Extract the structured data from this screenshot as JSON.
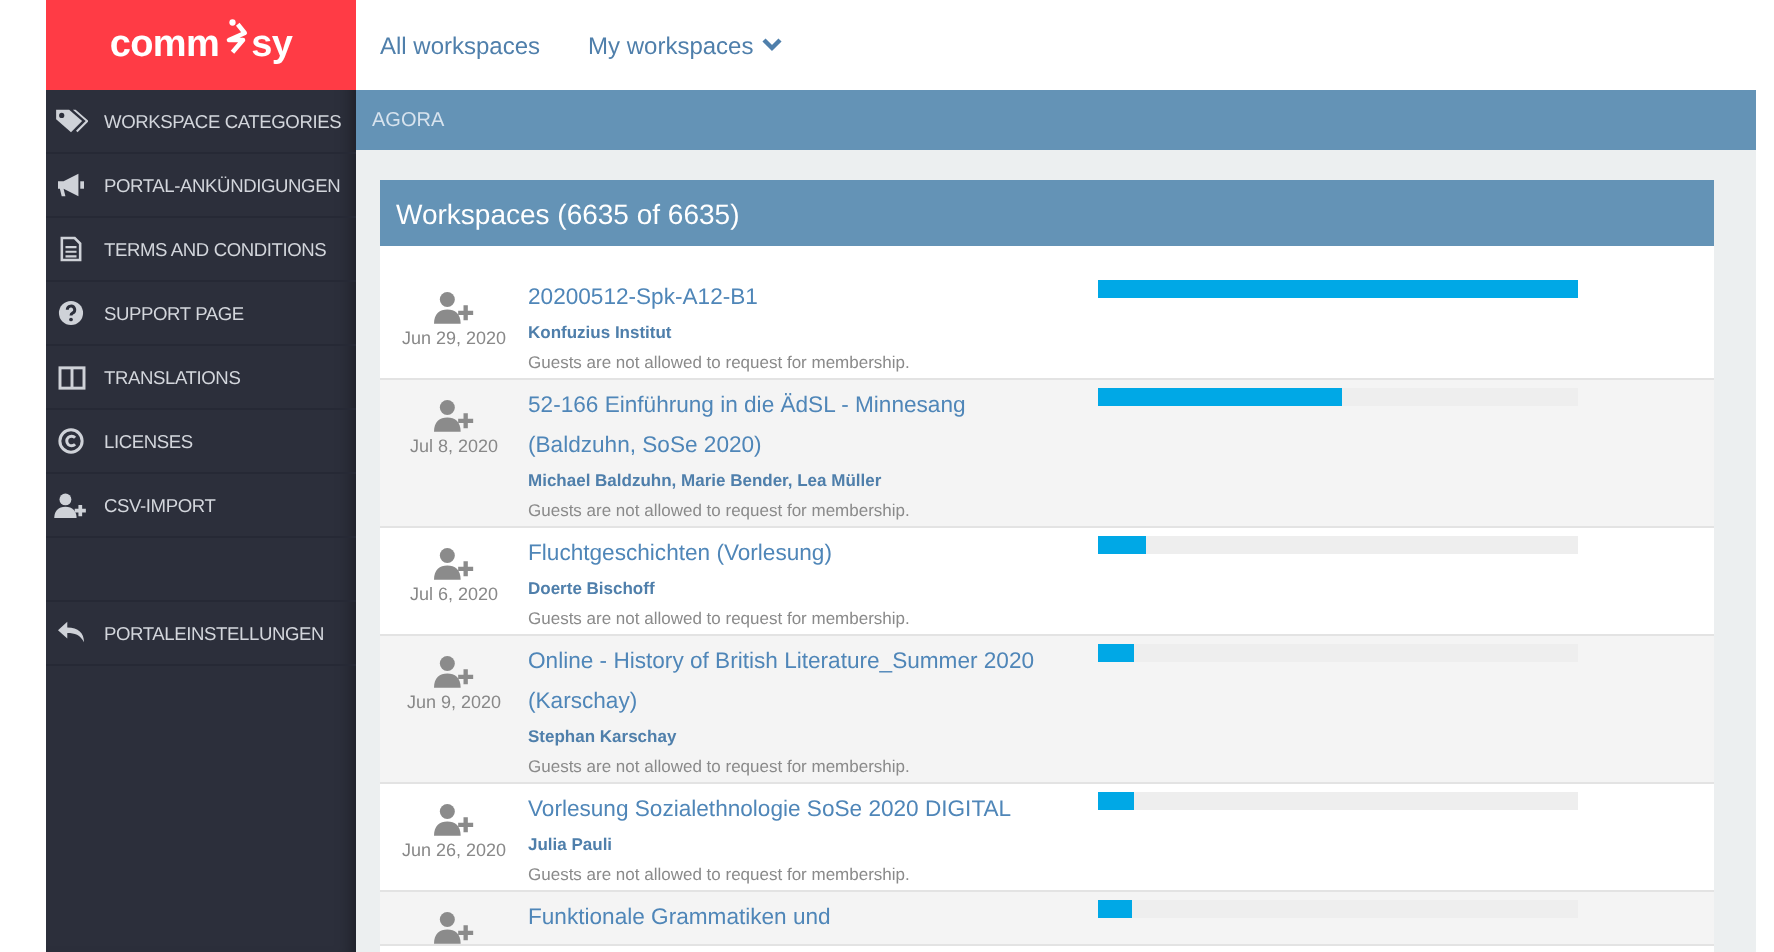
{
  "logo": {
    "left": "comm",
    "right": "sy"
  },
  "top_nav": [
    {
      "label": "All workspaces",
      "dropdown": false
    },
    {
      "label": "My workspaces",
      "dropdown": true
    }
  ],
  "sidebar": {
    "items": [
      {
        "label": "WORKSPACE CATEGORIES"
      },
      {
        "label": "PORTAL-ANKÜNDIGUNGEN"
      },
      {
        "label": "TERMS AND CONDITIONS"
      },
      {
        "label": "SUPPORT PAGE"
      },
      {
        "label": "TRANSLATIONS"
      },
      {
        "label": "LICENSES"
      },
      {
        "label": "CSV-IMPORT"
      }
    ],
    "footer_items": [
      {
        "label": "PORTALEINSTELLUNGEN"
      }
    ]
  },
  "breadcrumb": "AGORA",
  "panel": {
    "title": "Workspaces (6635 of 6635)",
    "rows": [
      {
        "title": "20200512-Spk-A12-B1",
        "date": "Jun 29, 2020",
        "members": "Konfuzius Institut",
        "note": "Guests are not allowed to request for membership.",
        "level": 1.0
      },
      {
        "title": "52-166 Einführung in die ÄdSL - Minnesang (Baldzuhn, SoSe 2020)",
        "date": "Jul 8, 2020",
        "members": "Michael Baldzuhn, Marie Bender, Lea Müller",
        "note": "Guests are not allowed to request for membership.",
        "level": 0.51
      },
      {
        "title": "Fluchtgeschichten (Vorlesung)",
        "date": "Jul 6, 2020",
        "members": "Doerte Bischoff",
        "note": "Guests are not allowed to request for membership.",
        "level": 0.1
      },
      {
        "title": "Online - History of British Literature_Summer 2020 (Karschay)",
        "date": "Jun 9, 2020",
        "members": "Stephan Karschay",
        "note": "Guests are not allowed to request for membership.",
        "level": 0.075
      },
      {
        "title": "Vorlesung Sozialethnologie SoSe 2020 DIGITAL",
        "date": "Jun 26, 2020",
        "members": "Julia Pauli",
        "note": "Guests are not allowed to request for membership.",
        "level": 0.075
      },
      {
        "title": "Funktionale Grammatiken und",
        "level": 0.07
      }
    ]
  }
}
